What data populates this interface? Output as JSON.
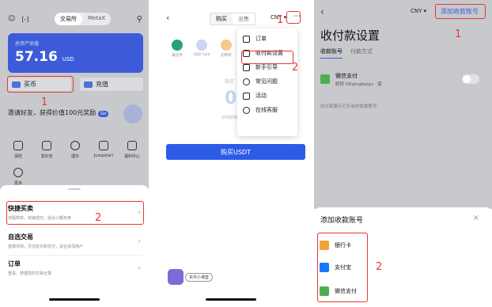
{
  "panel1": {
    "tabs": [
      "交易所",
      "MetaX"
    ],
    "asset_label": "总资产估值",
    "asset_value": "57.16",
    "asset_unit": "USD",
    "quick_buttons": [
      "买币",
      "充值"
    ],
    "invite_text": "邀请好友，获得价值100元奖励",
    "invite_badge": "Go",
    "grid": [
      "保险",
      "发红包",
      "理币",
      "Jumpstart",
      "福利中心"
    ],
    "more": "更多",
    "sheet": [
      {
        "title": "快捷买卖",
        "desc": "流程简单，快速成交，适合小额买卖"
      },
      {
        "title": "自选交易",
        "desc": "选择币商，灵活定价和支付，适合资深用户"
      },
      {
        "title": "订单",
        "desc": "查看、管理您的交易记录"
      }
    ],
    "annot1": "1",
    "annot2": "2"
  },
  "panel2": {
    "tabs": [
      "购买",
      "出售"
    ],
    "currency": "CNY",
    "coins": [
      "泰达币",
      "USD Coin",
      "比特币",
      "以太坊"
    ],
    "faded": "购买",
    "big": "0",
    "faded2": "您将获得 0 USDT",
    "menu": [
      "订单",
      "收付款设置",
      "新手引导",
      "常见问题",
      "活动",
      "在线客服"
    ],
    "buy_button": "购买USDT",
    "helper": "买币小课堂",
    "annot1": "1",
    "annot2": "2"
  },
  "panel3": {
    "currency": "CNY",
    "add_link": "添加收款账号",
    "title": "收付款设置",
    "tabs": [
      "收款账号",
      "付款方式"
    ],
    "wechat": "微信支付",
    "wechat_acct": "昵称 OKqingbaoju · 嵩",
    "hint": "向买家展示已开启的收款账号",
    "sheet_title": "添加收款账号",
    "close": "×",
    "options": [
      "银行卡",
      "支付宝",
      "微信支付"
    ],
    "annot1": "1",
    "annot2": "2"
  }
}
